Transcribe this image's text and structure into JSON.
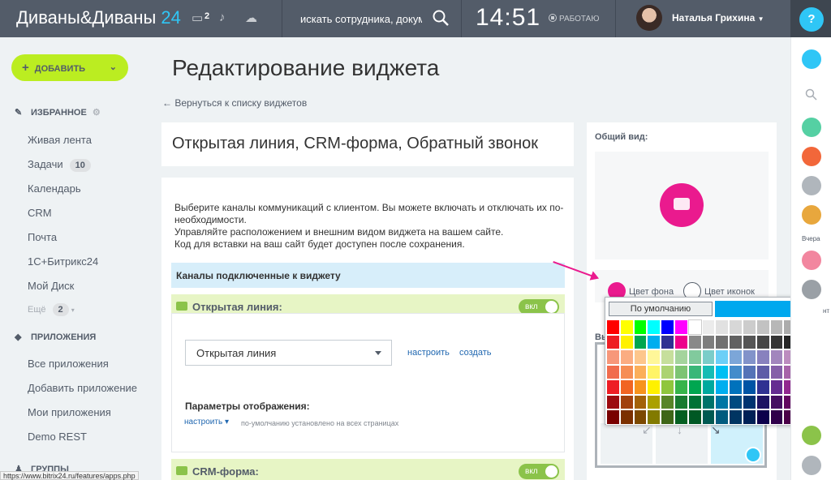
{
  "header": {
    "logo_text": "Диваны&Диваны",
    "logo_num": "24",
    "chat_count": "2",
    "search_placeholder": "искать сотрудника, документ...",
    "time": "14:51",
    "work_status": "РАБОТАЮ",
    "user_name": "Наталья Грихина",
    "help": "?"
  },
  "sidebar": {
    "add_label": "ДОБАВИТЬ",
    "favorites_title": "ИЗБРАННОЕ",
    "items": [
      {
        "label": "Живая лента"
      },
      {
        "label": "Задачи",
        "badge": "10"
      },
      {
        "label": "Календарь"
      },
      {
        "label": "CRM"
      },
      {
        "label": "Почта"
      },
      {
        "label": "1С+Битрикс24"
      },
      {
        "label": "Мой Диск"
      }
    ],
    "more_label": "Ещё",
    "more_badge": "2",
    "apps_title": "ПРИЛОЖЕНИЯ",
    "apps_items": [
      {
        "label": "Все приложения"
      },
      {
        "label": "Добавить приложение"
      },
      {
        "label": "Мои приложения"
      },
      {
        "label": "Demo REST"
      }
    ],
    "groups_title": "ГРУППЫ"
  },
  "main": {
    "title": "Редактирование виджета",
    "back_link": "← Вернуться к списку виджетов",
    "widget_name": "Открытая линия, CRM-форма, Обратный звонок",
    "description": [
      "Выберите каналы коммуникаций с клиентом. Вы можете включать и отключать их по-необходимости.",
      "Управляйте расположением и внешним видом виджета на вашем сайте.",
      "Код для вставки на ваш сайт будет доступен после сохранения."
    ],
    "channels_header": "Каналы подключенные к виджету",
    "open_line": {
      "title": "Открытая линия:",
      "toggle": "вкл",
      "select_value": "Открытая линия",
      "configure": "настроить",
      "create": "создать",
      "params_title": "Параметры отображения:",
      "params_configure": "настроить",
      "params_note": "по-умолчанию установлено на всех страницах"
    },
    "crm_form": {
      "title": "CRM-форма:",
      "toggle": "вкл"
    }
  },
  "right_panel": {
    "overview_label": "Общий вид:",
    "bg_color_label": "Цвет фона",
    "icon_color_label": "Цвет иконок",
    "bg_color": "#ea1a8e",
    "below_label": "Вы",
    "picker": {
      "default_label": "По умолчанию",
      "current_color": "#00a8ee",
      "rows": [
        [
          "#ff0000",
          "#ffff00",
          "#00ff00",
          "#00ffff",
          "#0000ff",
          "#ff00ff",
          "#ffffff",
          "#ebebeb",
          "#e1e1e1",
          "#d7d7d7",
          "#cccccc",
          "#c2c2c2",
          "#b7b7b7",
          "#acacac",
          "#a0a0a0",
          "#959595"
        ],
        [
          "#ee1d24",
          "#fff100",
          "#00a650",
          "#00aeef",
          "#2f3192",
          "#ed008c",
          "#898989",
          "#7d7d7d",
          "#707070",
          "#626262",
          "#555555",
          "#464646",
          "#363636",
          "#262626",
          "#111111",
          "#000000"
        ],
        [
          "#f7977a",
          "#fbad82",
          "#fdc68c",
          "#fff799",
          "#c6df9c",
          "#a4d49d",
          "#81ca9d",
          "#7bcdc9",
          "#6ccff7",
          "#7ca6d8",
          "#8293ca",
          "#8881be",
          "#a286bd",
          "#bc8cbf",
          "#f49bc1",
          "#f5999d"
        ],
        [
          "#f16c4d",
          "#f68e54",
          "#fbaf5a",
          "#fff467",
          "#acd372",
          "#7dc473",
          "#39b778",
          "#16bcb4",
          "#00bff3",
          "#438ccb",
          "#5573b7",
          "#5e5ca7",
          "#855fa8",
          "#a763a9",
          "#ef6ea8",
          "#f16d7e"
        ],
        [
          "#ee1d24",
          "#f16522",
          "#f7941d",
          "#fff100",
          "#8fc63d",
          "#37b44a",
          "#00a650",
          "#00a99e",
          "#00aeef",
          "#0072bc",
          "#0054a5",
          "#2f3192",
          "#652c91",
          "#91278f",
          "#ed008c",
          "#ee105a"
        ],
        [
          "#9d0a0f",
          "#a1410d",
          "#a36209",
          "#aba000",
          "#588528",
          "#197b30",
          "#007236",
          "#00736a",
          "#0076a4",
          "#004a80",
          "#003370",
          "#1d1363",
          "#450e61",
          "#62055f",
          "#9e005c",
          "#9d0039"
        ],
        [
          "#790000",
          "#7b3000",
          "#7c4900",
          "#827a00",
          "#3e6617",
          "#045f20",
          "#005824",
          "#005951",
          "#005b7e",
          "#003562",
          "#002056",
          "#0c004b",
          "#30004a",
          "#4b0048",
          "#7a0045",
          "#7a0026"
        ]
      ]
    }
  },
  "rightbar": {
    "yesterday": "Вчера",
    "cut_label": "нт"
  },
  "status_url": "https://www.bitrix24.ru/features/apps.php"
}
